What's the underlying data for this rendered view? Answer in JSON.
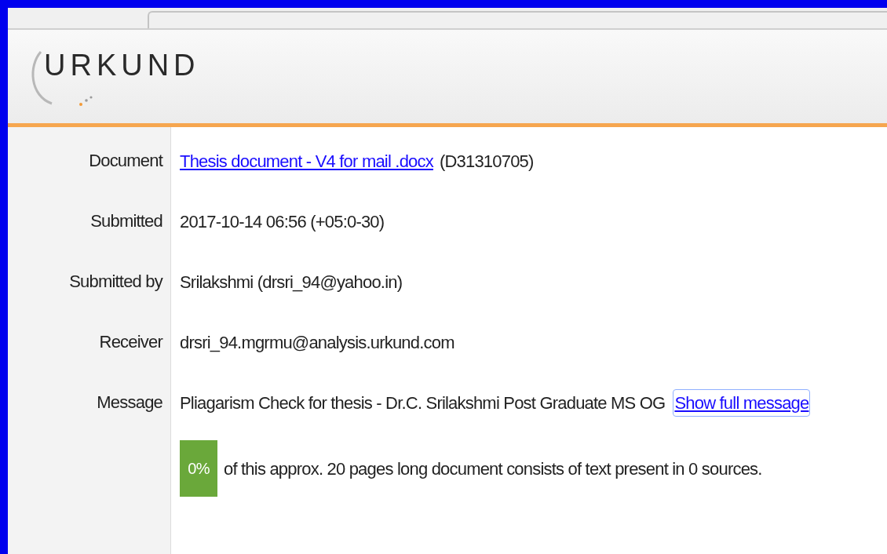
{
  "logo": {
    "text": "URKUND"
  },
  "details": [
    {
      "label": "Document",
      "link": "Thesis document - V4 for mail .docx",
      "value": "(D31310705)"
    },
    {
      "label": "Submitted",
      "value": "2017-10-14 06:56 (+05:0-30)"
    },
    {
      "label": "Submitted by",
      "value": "Srilakshmi (drsri_94@yahoo.in)"
    },
    {
      "label": "Receiver",
      "value": "drsri_94.mgrmu@analysis.urkund.com"
    },
    {
      "label": "Message",
      "value": "Pliagarism Check for thesis - Dr.C. Srilakshmi Post Graduate MS OG",
      "link_after": "Show full message"
    }
  ],
  "result": {
    "percentage": "0%",
    "text": "of this approx. 20 pages long document consists of text present in 0 sources."
  }
}
